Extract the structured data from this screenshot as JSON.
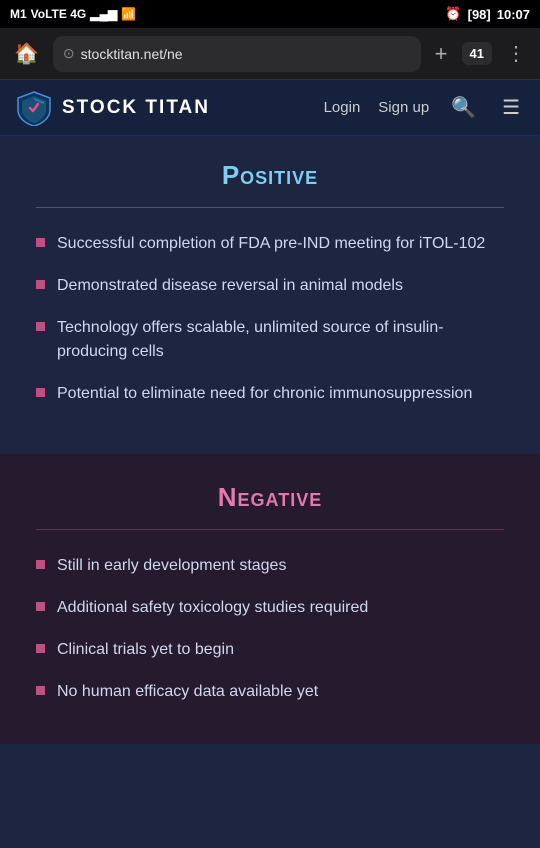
{
  "status": {
    "carrier": "M1",
    "network": "VoLTE 4G",
    "signal": "▂▄▆",
    "wifi": "WiFi",
    "time": "10:07",
    "battery_pct": "98",
    "alarm": "⏰"
  },
  "browser": {
    "url": "stocktitan.net/ne",
    "tabs_count": "41",
    "home_icon": "🏠",
    "add_icon": "+",
    "menu_icon": "⋮"
  },
  "nav": {
    "title": "STOCK TITAN",
    "login_label": "Login",
    "signup_label": "Sign up"
  },
  "positive": {
    "title": "Positive",
    "bullets": [
      "Successful completion of FDA pre-IND meeting for iTOL-102",
      "Demonstrated disease reversal in animal models",
      "Technology offers scalable, unlimited source of insulin-producing cells",
      "Potential to eliminate need for chronic immunosuppression"
    ]
  },
  "negative": {
    "title": "Negative",
    "bullets": [
      "Still in early development stages",
      "Additional safety toxicology studies required",
      "Clinical trials yet to begin",
      "No human efficacy data available yet"
    ]
  }
}
